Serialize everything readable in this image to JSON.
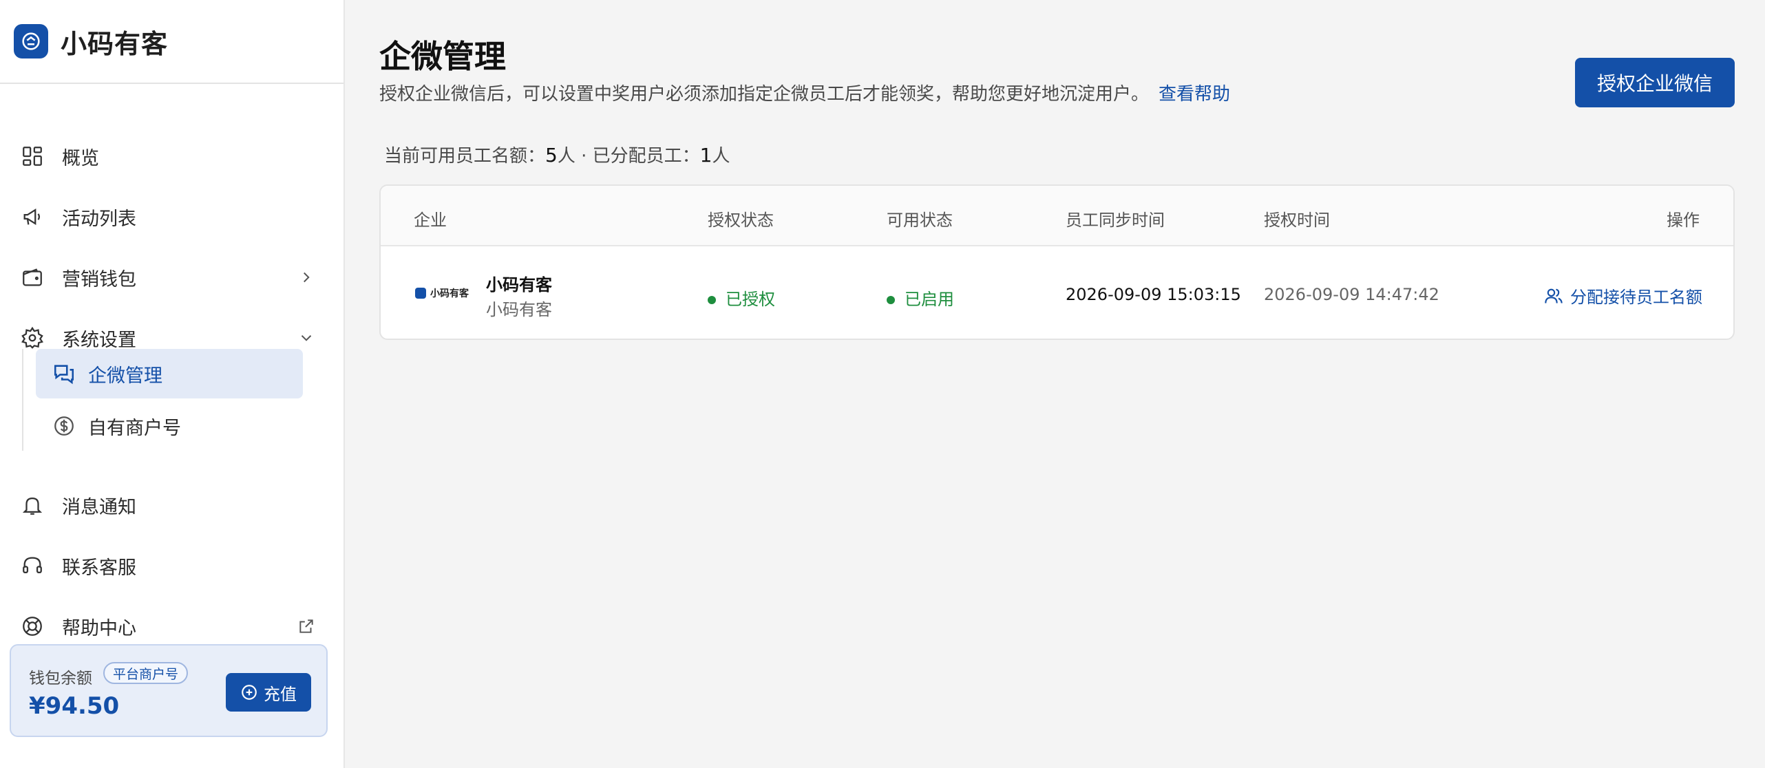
{
  "brand": {
    "name": "小码有客",
    "logo_icon": "customer-service-icon",
    "accent": "#1450a8"
  },
  "sidebar": {
    "items": [
      {
        "label": "概览",
        "icon": "dashboard-grid-icon"
      },
      {
        "label": "活动列表",
        "icon": "megaphone-icon"
      },
      {
        "label": "营销钱包",
        "icon": "wallet-icon",
        "arrow": "chevron-right-icon"
      },
      {
        "label": "系统设置",
        "icon": "gear-icon",
        "arrow": "chevron-down-icon",
        "expanded": true
      },
      {
        "label": "消息通知",
        "icon": "bell-icon"
      },
      {
        "label": "联系客服",
        "icon": "headset-icon"
      },
      {
        "label": "帮助中心",
        "icon": "lifebuoy-icon",
        "arrow": "external-link-icon"
      }
    ],
    "sub_items": [
      {
        "label": "企微管理",
        "icon": "chat-bubbles-icon",
        "active": true
      },
      {
        "label": "自有商户号",
        "icon": "dollar-circle-icon",
        "active": false
      }
    ]
  },
  "wallet": {
    "title": "钱包余额",
    "badge": "平台商户号",
    "amount": "¥94.50",
    "recharge_label": "充值"
  },
  "main": {
    "title": "企微管理",
    "description": "授权企业微信后，可以设置中奖用户必须添加指定企微员工后才能领奖，帮助您更好地沉淀用户。",
    "help_link": "查看帮助",
    "auth_button": "授权企业微信",
    "quota": {
      "label_available": "当前可用员工名额：",
      "available": "5",
      "unit1": "人 · 已分配员工：",
      "assigned": "1",
      "unit2": "人"
    },
    "table": {
      "headers": [
        "企业",
        "授权状态",
        "可用状态",
        "员工同步时间",
        "授权时间",
        "操作"
      ],
      "rows": [
        {
          "logo_text": "小码有客",
          "company_name": "小码有客",
          "company_sub": "小码有客",
          "auth_status": "已授权",
          "available_status": "已启用",
          "sync_time": "2026-09-09 15:03:15",
          "auth_time": "2026-09-09 14:47:42",
          "action": "分配接待员工名额"
        }
      ]
    }
  },
  "colors": {
    "status_green": "#1e8e3e",
    "primary": "#1450a8"
  }
}
